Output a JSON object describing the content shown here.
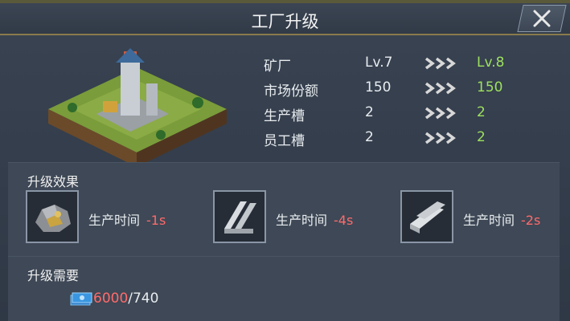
{
  "window": {
    "title": "工厂升级"
  },
  "upgrade": {
    "rows": [
      {
        "label": "矿厂",
        "current": "Lv.7",
        "next": "Lv.8"
      },
      {
        "label": "市场份额",
        "current": "150",
        "next": "150"
      },
      {
        "label": "生产槽",
        "current": "2",
        "next": "2"
      },
      {
        "label": "员工槽",
        "current": "2",
        "next": "2"
      }
    ]
  },
  "effects": {
    "title": "升级效果",
    "items": [
      {
        "icon": "ore-icon",
        "label": "生产时间",
        "value": "-1s"
      },
      {
        "icon": "steel-beam-icon",
        "label": "生产时间",
        "value": "-4s"
      },
      {
        "icon": "steel-bars-icon",
        "label": "生产时间",
        "value": "-2s"
      }
    ]
  },
  "requirements": {
    "title": "升级需要",
    "icon": "cash-icon",
    "have": "6000",
    "need": "/740"
  },
  "colors": {
    "next_value": "#9ee05f",
    "reduction": "#ff6b6b"
  }
}
